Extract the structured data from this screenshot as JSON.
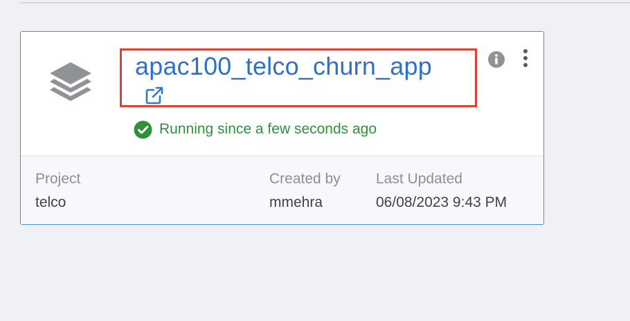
{
  "app_card": {
    "title": "apac100_telco_churn_app",
    "status_text": "Running since a few seconds ago",
    "status": "running",
    "icons": {
      "app": "stacked-layers-icon",
      "external_link": "external-link-icon",
      "info": "info-icon",
      "more": "vertical-dots-icon",
      "status": "check-circle-icon"
    },
    "colors": {
      "title": "#2f6fcc",
      "status": "#2f8f3a",
      "highlight": "#e0402f",
      "card_border": "#4a8fdb"
    },
    "metadata": {
      "project_label": "Project",
      "project_value": "telco",
      "created_by_label": "Created by",
      "created_by_value": "mmehra",
      "last_updated_label": "Last Updated",
      "last_updated_value": "06/08/2023 9:43 PM"
    }
  }
}
